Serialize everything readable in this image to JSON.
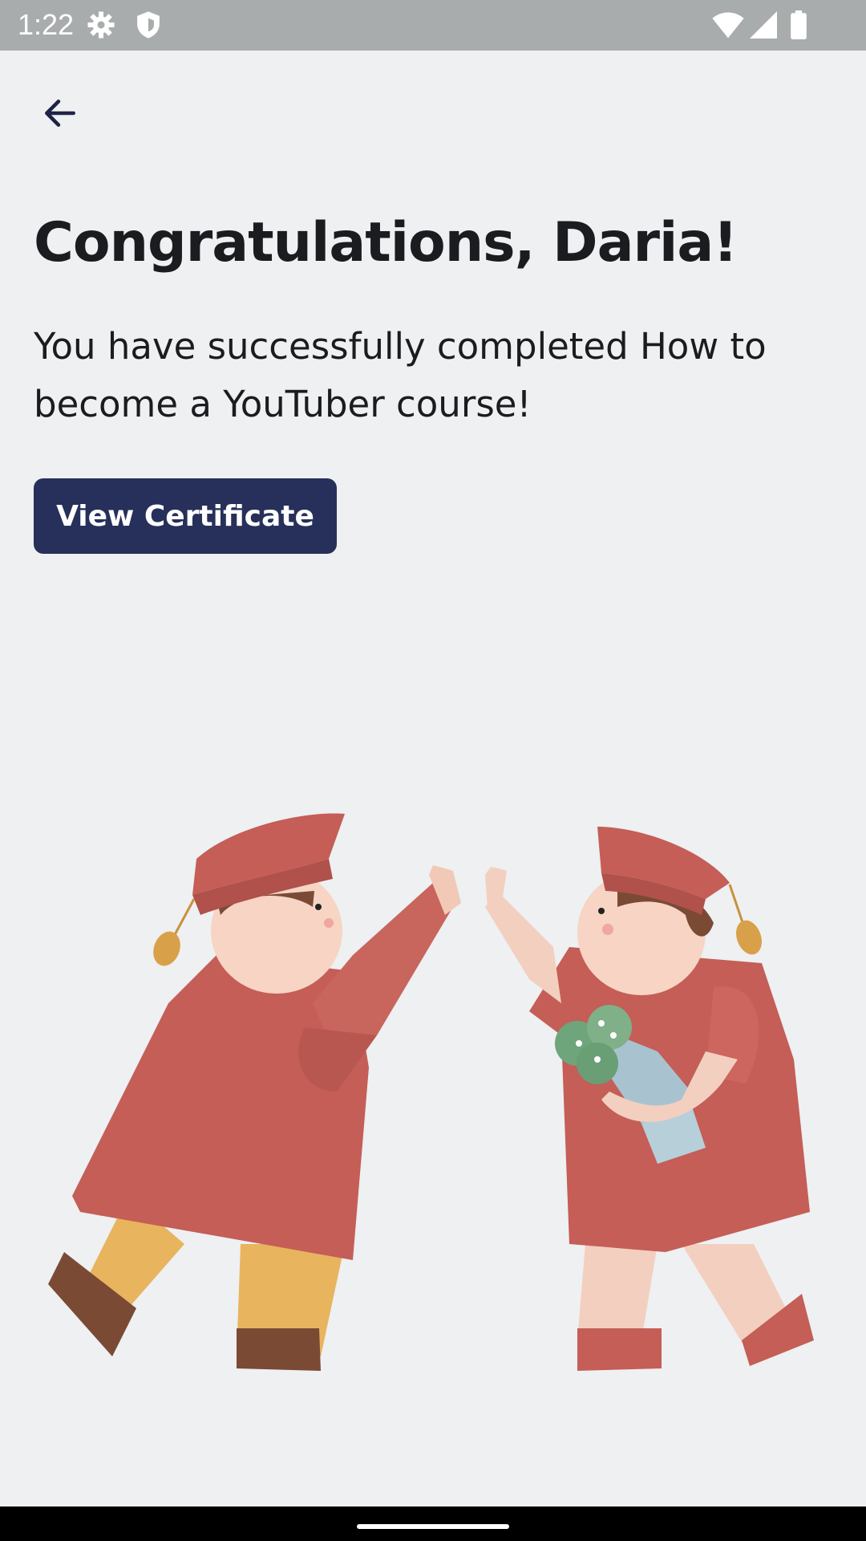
{
  "status_bar": {
    "time": "1:22",
    "icons": [
      "settings-icon",
      "shield-icon",
      "wifi-icon",
      "signal-icon",
      "battery-icon"
    ]
  },
  "header": {
    "back_icon": "arrow-left-icon"
  },
  "main": {
    "title": "Congratulations, Daria!",
    "message": "You have successfully completed How to become a YouTuber course!",
    "button_label": "View Certificate"
  },
  "colors": {
    "background": "#eef0f2",
    "status_bar": "#a9acad",
    "button": "#27305a",
    "text": "#1b1c1f",
    "gown": "#c35f58"
  }
}
